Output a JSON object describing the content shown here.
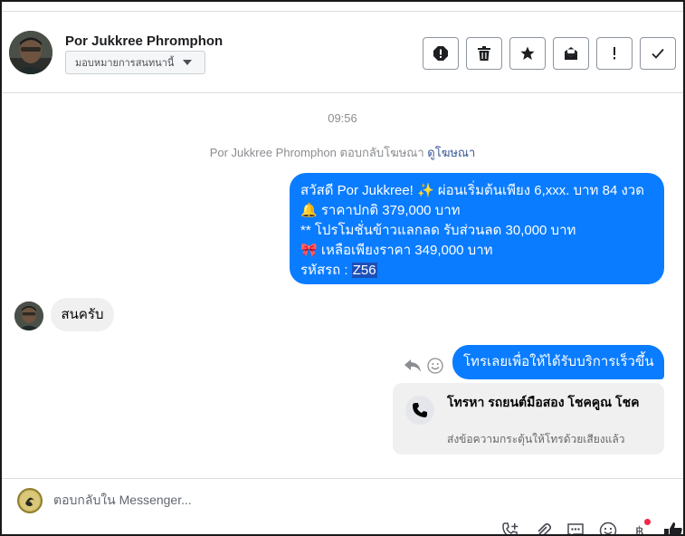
{
  "header": {
    "contact_name": "Por Jukkree Phromphon",
    "assign_label": "มอบหมายการสนทนานี้",
    "tools": [
      {
        "name": "spam-icon"
      },
      {
        "name": "trash-icon"
      },
      {
        "name": "star-icon"
      },
      {
        "name": "mark-unread-icon"
      },
      {
        "name": "exclamation-icon"
      },
      {
        "name": "check-icon"
      }
    ]
  },
  "thread": {
    "timestamp": "09:56",
    "reply_note": "Por Jukkree Phromphon ตอบกลับโฆษณา",
    "reply_note_link": "ดูโฆษณา",
    "outgoing_1": {
      "line1": "สวัสดี Por Jukkree! ✨  ผ่อนเริ่มต้นเพียง 6,xxx. บาท 84 งวด",
      "line2": "🔔 ราคาปกติ 379,000 บาท",
      "line3": "** โปรโมชั่นข้าวแลกลด รับส่วนลด 30,000 บาท",
      "line4": "🎀  เหลือเพียงราคา 349,000 บาท",
      "line5_prefix": " รหัสรถ : ",
      "line5_code": "Z56"
    },
    "incoming_1": "สนครับ",
    "outgoing_2": "โทรเลยเพื่อให้ได้รับบริการเร็วขึ้น",
    "cta": {
      "title": "โทรหา รถยนต์มือสอง โชคคูณ โชค",
      "subtitle": "ส่งข้อความกระตุ้นให้โทรด้วยเสียงแล้ว"
    }
  },
  "composer": {
    "placeholder": "ตอบกลับใน Messenger..."
  },
  "colors": {
    "outgoing_bubble": "#0a7cff",
    "incoming_bubble": "#f0f0f0",
    "link": "#385898",
    "notification_dot": "#f02849"
  }
}
